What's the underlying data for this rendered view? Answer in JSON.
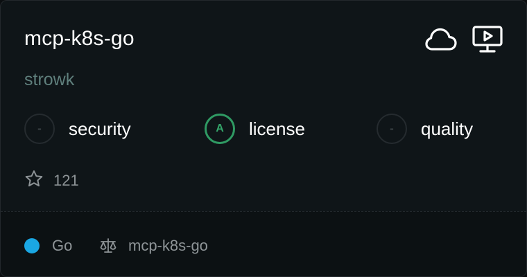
{
  "repo": {
    "name": "mcp-k8s-go",
    "owner": "strowk",
    "stars": "121"
  },
  "icons": {
    "cloud": "cloud-icon",
    "local": "monitor-play-icon",
    "star": "star-icon",
    "license": "scale-icon"
  },
  "metrics": [
    {
      "grade": "-",
      "label": "security"
    },
    {
      "grade": "A",
      "label": "license"
    },
    {
      "grade": "-",
      "label": "quality"
    }
  ],
  "footer": {
    "language": "Go",
    "language_color": "#1aa7e3",
    "license_name": "mcp-k8s-go"
  },
  "colors": {
    "accent_good": "#2f9a63",
    "owner_text": "#5f7f7c"
  }
}
